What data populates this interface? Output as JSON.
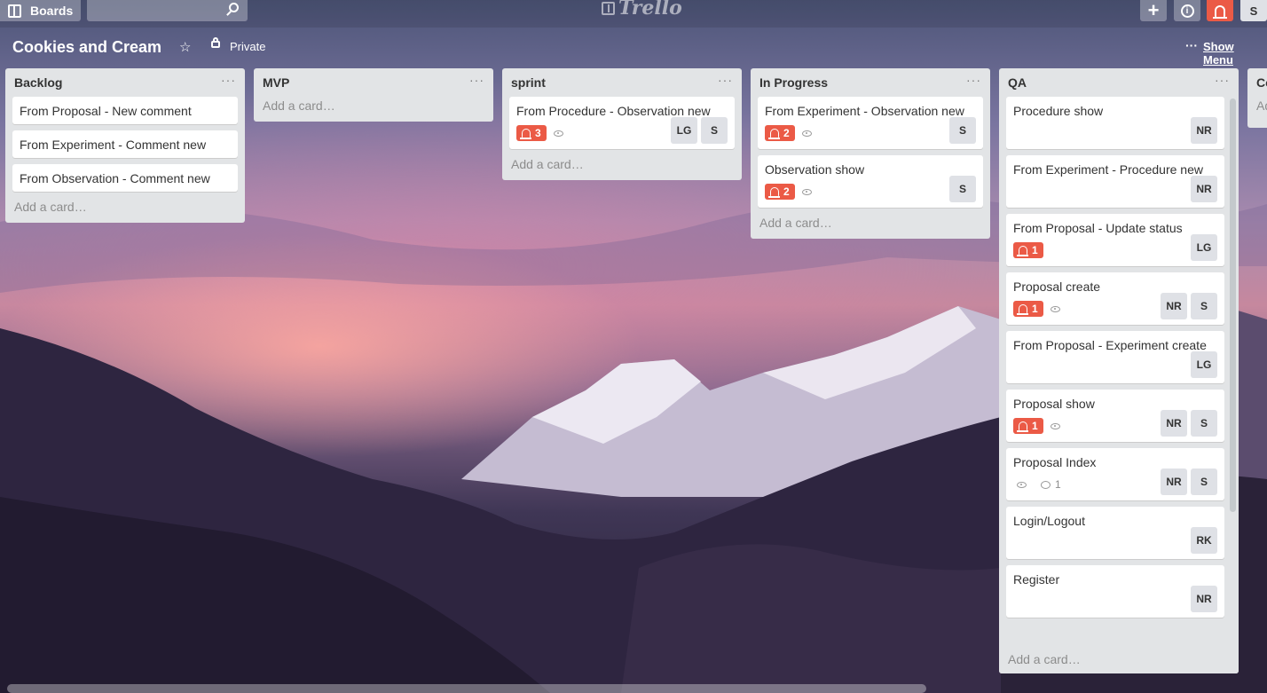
{
  "header": {
    "boards_label": "Boards",
    "search_placeholder": "",
    "logo_text": "Trello",
    "avatar_initial": "S"
  },
  "board": {
    "title": "Cookies and Cream",
    "privacy": "Private",
    "show_menu_label": "Show Menu",
    "menu_dots": "···"
  },
  "add_card_label": "Add a card…",
  "lists": [
    {
      "title": "Backlog",
      "cards": [
        {
          "title": "From Proposal - New comment"
        },
        {
          "title": "From Experiment - Comment new"
        },
        {
          "title": "From Observation - Comment new"
        }
      ]
    },
    {
      "title": "MVP",
      "cards": []
    },
    {
      "title": "sprint",
      "cards": [
        {
          "title": "From Procedure - Observation new",
          "notifications": "3",
          "watch": true,
          "members": [
            "LG",
            "S"
          ]
        }
      ]
    },
    {
      "title": "In Progress",
      "cards": [
        {
          "title": "From Experiment - Observation new",
          "notifications": "2",
          "watch": true,
          "members": [
            "S"
          ]
        },
        {
          "title": "Observation show",
          "notifications": "2",
          "watch": true,
          "members": [
            "S"
          ]
        }
      ]
    },
    {
      "title": "QA",
      "cards": [
        {
          "title": "Procedure show",
          "members": [
            "NR"
          ]
        },
        {
          "title": "From Experiment - Procedure new",
          "members": [
            "NR"
          ]
        },
        {
          "title": "From Proposal - Update status",
          "notifications": "1",
          "members": [
            "LG"
          ]
        },
        {
          "title": "Proposal create",
          "notifications": "1",
          "watch": true,
          "members": [
            "NR",
            "S"
          ]
        },
        {
          "title": "From Proposal - Experiment create",
          "members": [
            "LG"
          ]
        },
        {
          "title": "Proposal show",
          "notifications": "1",
          "watch": true,
          "members": [
            "NR",
            "S"
          ]
        },
        {
          "title": "Proposal Index",
          "watch": true,
          "comments": "1",
          "members": [
            "NR",
            "S"
          ]
        },
        {
          "title": "Login/Logout",
          "members": [
            "RK"
          ]
        },
        {
          "title": "Register",
          "members": [
            "NR"
          ]
        }
      ]
    }
  ],
  "partial_list": {
    "title": "Co",
    "add_card_label": "Ad"
  },
  "colors": {
    "notification": "#eb5a46",
    "list_bg": "#e2e4e6",
    "card_bg": "#ffffff",
    "member_bg": "#dfe1e6"
  }
}
